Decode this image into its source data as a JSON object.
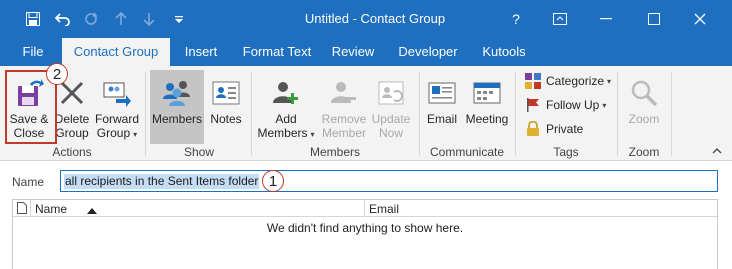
{
  "window": {
    "title": "Untitled  -  Contact Group",
    "help": "?",
    "colors": {
      "titlebar": "#1e6fc0",
      "ribbon": "#f3f3f3",
      "annotation": "#c0392b"
    }
  },
  "tabs": [
    "File",
    "Contact Group",
    "Insert",
    "Format Text",
    "Review",
    "Developer",
    "Kutools"
  ],
  "ribbon": {
    "actions": {
      "save_close": "Save &\nClose",
      "delete_group": "Delete\nGroup",
      "forward_group": "Forward\nGroup",
      "group_label": "Actions"
    },
    "show": {
      "members": "Members",
      "notes": "Notes",
      "group_label": "Show"
    },
    "members_group": {
      "add_members": "Add\nMembers",
      "remove_member": "Remove\nMember",
      "update_now": "Update\nNow",
      "group_label": "Members"
    },
    "communicate": {
      "email": "Email",
      "meeting": "Meeting",
      "group_label": "Communicate"
    },
    "tags": {
      "categorize": "Categorize",
      "follow_up": "Follow Up",
      "private": "Private",
      "group_label": "Tags"
    },
    "zoom": {
      "zoom": "Zoom",
      "group_label": "Zoom"
    }
  },
  "form": {
    "name_label": "Name",
    "name_value": "all recipients in the Sent Items folder"
  },
  "list": {
    "columns": [
      "Name",
      "Email"
    ],
    "empty_message": "We didn't find anything to show here."
  },
  "annotations": {
    "step1": "1",
    "step2": "2"
  }
}
